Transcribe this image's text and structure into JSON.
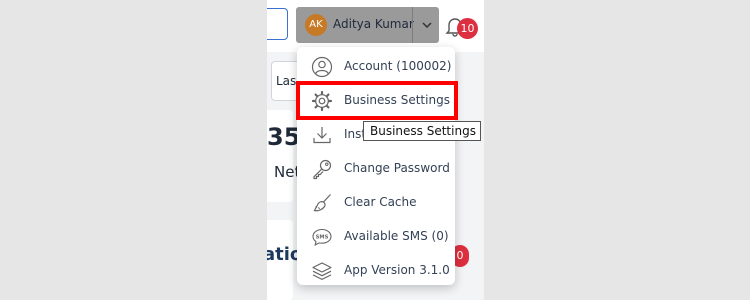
{
  "header": {
    "user": {
      "initials": "AK",
      "name": "Aditya Kumar"
    },
    "notifications": {
      "count": "10"
    }
  },
  "background": {
    "filter_text": "Las",
    "stat_value": "35",
    "stat_label": "Net",
    "section_title": "atio",
    "section_badge": "0"
  },
  "menu": {
    "items": [
      {
        "label": "Account (100002)",
        "icon": "user-icon"
      },
      {
        "label": "Business Settings",
        "icon": "gear-icon"
      },
      {
        "label": "Inst",
        "icon": "download-icon"
      },
      {
        "label": "Change Password",
        "icon": "key-icon"
      },
      {
        "label": "Clear Cache",
        "icon": "broom-icon"
      },
      {
        "label": "Available SMS (0)",
        "icon": "sms-icon"
      },
      {
        "label": "App Version 3.1.0",
        "icon": "layers-icon"
      }
    ]
  },
  "tooltip": {
    "text": "Business Settings"
  },
  "colors": {
    "highlight": "#ff0000",
    "badge": "#dc2f3f",
    "avatar": "#c77a25",
    "user_button": "#9a9a9a"
  }
}
